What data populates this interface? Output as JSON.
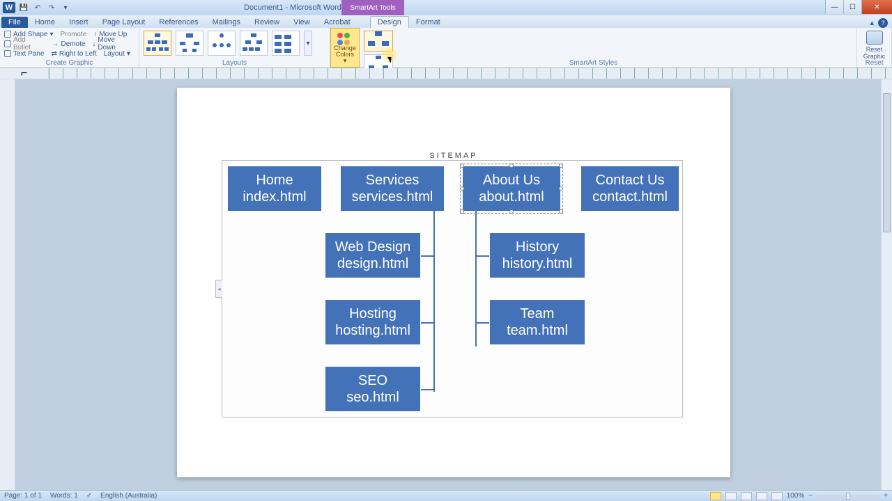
{
  "app": {
    "title": "Document1 - Microsoft Word",
    "contextual_tab_group": "SmartArt Tools"
  },
  "tabs": {
    "file": "File",
    "items": [
      "Home",
      "Insert",
      "Page Layout",
      "References",
      "Mailings",
      "Review",
      "View",
      "Acrobat"
    ],
    "contextual": [
      "Design",
      "Format"
    ],
    "active": "Design"
  },
  "ribbon": {
    "create_graphic": {
      "label": "Create Graphic",
      "add_shape": "Add Shape",
      "add_bullet": "Add Bullet",
      "text_pane": "Text Pane",
      "promote": "Promote",
      "demote": "Demote",
      "right_to_left": "Right to Left",
      "move_up": "Move Up",
      "move_down": "Move Down",
      "layout": "Layout"
    },
    "layouts": {
      "label": "Layouts"
    },
    "change_colors": {
      "label1": "Change",
      "label2": "Colors"
    },
    "smartart_styles": {
      "label": "SmartArt Styles"
    },
    "reset": {
      "label": "Reset",
      "button1": "Reset",
      "button2": "Graphic"
    }
  },
  "sitemap": {
    "title": "SITEMAP",
    "nodes": {
      "home": {
        "line1": "Home",
        "line2": "index.html"
      },
      "services": {
        "line1": "Services",
        "line2": "services.html"
      },
      "about": {
        "line1": "About Us",
        "line2": "about.html"
      },
      "contact": {
        "line1": "Contact Us",
        "line2": "contact.html"
      },
      "webdesign": {
        "line1": "Web Design",
        "line2": "design.html"
      },
      "hosting": {
        "line1": "Hosting",
        "line2": "hosting.html"
      },
      "seo": {
        "line1": "SEO",
        "line2": "seo.html"
      },
      "history": {
        "line1": "History",
        "line2": "history.html"
      },
      "team": {
        "line1": "Team",
        "line2": "team.html"
      }
    },
    "selected": "about"
  },
  "statusbar": {
    "page": "Page: 1 of 1",
    "words": "Words: 1",
    "language": "English (Australia)",
    "zoom": "100%"
  },
  "colors": {
    "accent": "#4472b8",
    "ribbon_bg": "#f2f6fb",
    "highlight": "#ffe790"
  }
}
